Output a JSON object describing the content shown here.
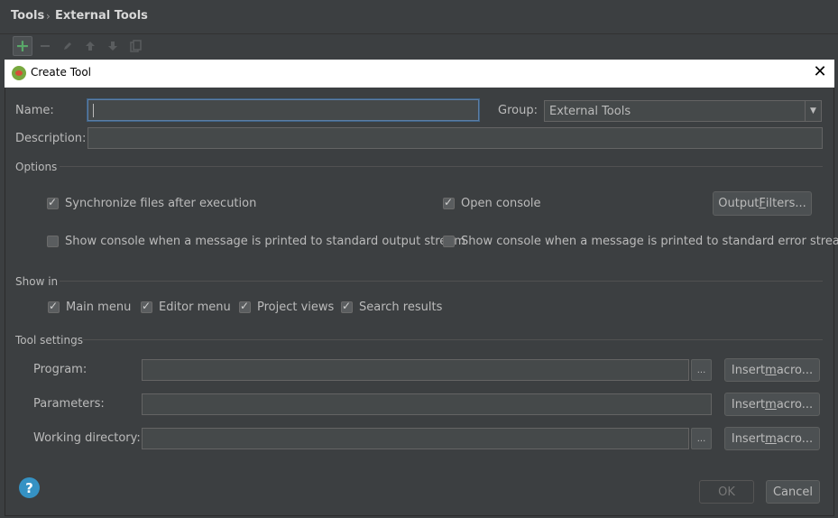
{
  "breadcrumb": {
    "root": "Tools",
    "separator": "›",
    "current": "External Tools"
  },
  "toolbar": {
    "add_icon": "plus-icon",
    "remove_icon": "minus-icon",
    "edit_icon": "pencil-icon",
    "up_icon": "arrow-up-icon",
    "down_icon": "arrow-down-icon",
    "copy_icon": "copy-icon"
  },
  "dialog": {
    "title": "Create Tool",
    "close_glyph": "✕",
    "name_label": "Name:",
    "name_value": "",
    "group_label": "Group:",
    "group_value": "External Tools",
    "description_label": "Description:",
    "description_value": "",
    "options": {
      "header": "Options",
      "sync_files": {
        "label": "Synchronize files after execution",
        "checked": true
      },
      "open_console": {
        "label": "Open console",
        "checked": true
      },
      "output_filters_pre": "Output ",
      "output_filters_mnemonic": "F",
      "output_filters_post": "ilters...",
      "show_console_stdout": {
        "label": "Show console when a message is printed to standard output stream",
        "checked": false
      },
      "show_console_stderr": {
        "label": "Show console when a message is printed to standard error stream",
        "checked": false
      }
    },
    "show_in": {
      "header": "Show in",
      "main_menu": {
        "label": "Main menu",
        "checked": true
      },
      "editor_menu": {
        "label": "Editor menu",
        "checked": true
      },
      "project_views": {
        "label": "Project views",
        "checked": true
      },
      "search_results": {
        "label": "Search results",
        "checked": true
      }
    },
    "tool_settings": {
      "header": "Tool settings",
      "program_label": "Program:",
      "program_value": "",
      "parameters_label": "Parameters:",
      "parameters_value": "",
      "working_dir_label": "Working directory:",
      "working_dir_value": "",
      "browse_glyph": "...",
      "insert_macro_pre": "Insert ",
      "insert_macro_mnemonic": "m",
      "insert_macro_post": "acro..."
    },
    "ok_label": "OK",
    "cancel_label": "Cancel",
    "help_glyph": "?"
  },
  "colors": {
    "background": "#3c3f41",
    "field_background": "#45494a",
    "focus_border": "#5c7ea6",
    "add_green": "#59a869",
    "help_blue": "#3592c4"
  }
}
